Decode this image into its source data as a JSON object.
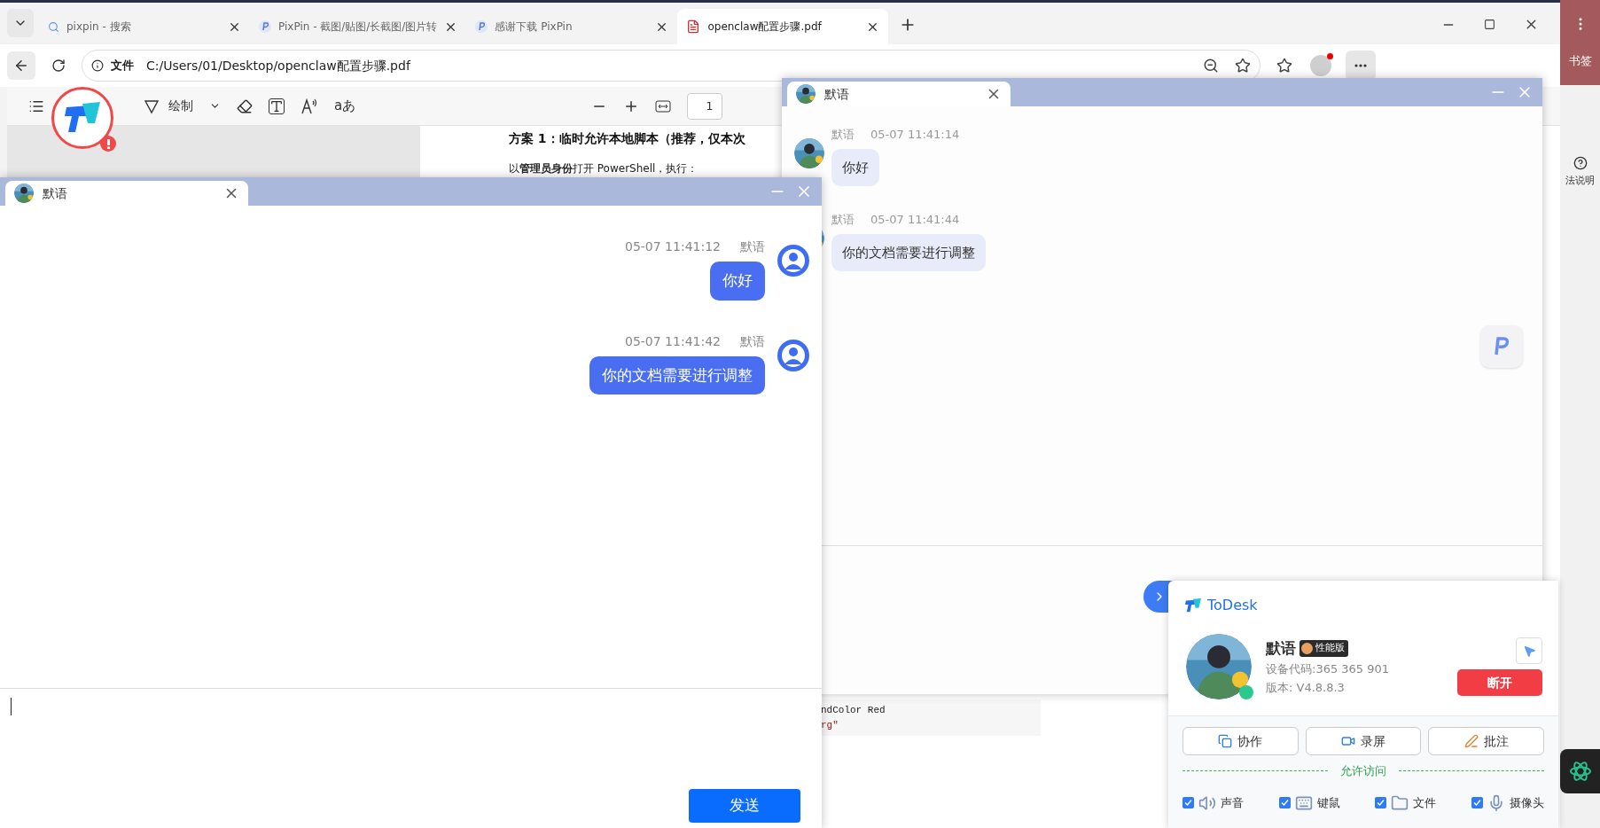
{
  "browser": {
    "tabs": [
      {
        "kind": "search",
        "title": "pixpin - 搜索",
        "selected": false
      },
      {
        "kind": "site",
        "title": "PixPin - 截图/贴图/长截图/图片转",
        "selected": false
      },
      {
        "kind": "site",
        "title": "感谢下载 PixPin",
        "selected": false
      },
      {
        "kind": "pdf",
        "title": "openclaw配置步骤.pdf",
        "selected": true
      }
    ],
    "address": {
      "scheme": "文件",
      "url": "C:/Users/01/Desktop/openclaw配置步骤.pdf"
    },
    "side_labels": [
      "书签",
      "法说明"
    ]
  },
  "pdf_toolbar": {
    "draw_label": "绘制",
    "read_label": "aあ",
    "page": "1"
  },
  "pdf": {
    "heading": "方案 1：临时允许本地脚本（推荐，仅本次",
    "intro": "以**管理员身份**打开 PowerShell，执行：",
    "code": [
      {
        "kind": "plain",
        "text": "ndColor Red"
      },
      {
        "kind": "string",
        "text": "rg\""
      }
    ]
  },
  "chat_left": {
    "contact": "默语",
    "messages": [
      {
        "time": "05-07 11:41:12",
        "sender": "默语",
        "text": "你好"
      },
      {
        "time": "05-07 11:41:42",
        "sender": "默语",
        "text": "你的文档需要进行调整"
      }
    ],
    "send_label": "发送"
  },
  "chat_right": {
    "contact": "默语",
    "messages": [
      {
        "time": "05-07 11:41:14",
        "sender": "默语",
        "text": "你好"
      },
      {
        "time": "05-07 11:41:44",
        "sender": "默语",
        "text": "你的文档需要进行调整"
      }
    ]
  },
  "todesk": {
    "brand": "ToDesk",
    "name": "默语",
    "badge": "性能版",
    "device_code": "设备代码:365 365 901",
    "version": "版本: V4.8.8.3",
    "disconnect": "断开",
    "actions": [
      {
        "kind": "collab",
        "label": "协作"
      },
      {
        "kind": "record",
        "label": "录屏"
      },
      {
        "kind": "annotate",
        "label": "批注"
      }
    ],
    "access_title": "允许访问",
    "permissions": [
      {
        "kind": "sound",
        "label": "声音",
        "checked": true
      },
      {
        "kind": "keyboard",
        "label": "键鼠",
        "checked": true
      },
      {
        "kind": "file",
        "label": "文件",
        "checked": true
      },
      {
        "kind": "camera",
        "label": "摄像头",
        "checked": true
      }
    ]
  }
}
